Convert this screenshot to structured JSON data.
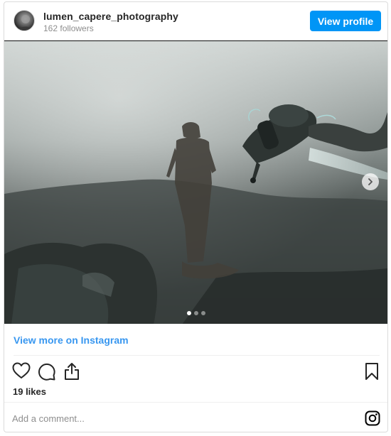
{
  "header": {
    "username": "lumen_capere_photography",
    "followers": "162 followers",
    "view_profile_label": "View profile"
  },
  "carousel": {
    "slide_count": 3,
    "active_slide": 1
  },
  "link": {
    "view_more_label": "View more on Instagram"
  },
  "actions": {
    "icons": [
      "heart-icon",
      "comment-icon",
      "share-icon",
      "bookmark-icon"
    ],
    "likes": "19 likes"
  },
  "comment": {
    "placeholder": "Add a comment..."
  },
  "colors": {
    "accent": "#0095f6",
    "link": "#3897f0",
    "muted": "#8e8e8e"
  }
}
